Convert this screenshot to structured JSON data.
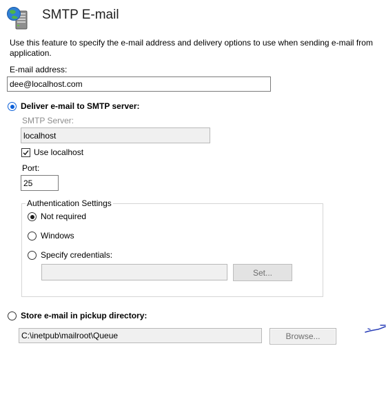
{
  "header": {
    "title": "SMTP E-mail",
    "icon": "smtp-server-icon"
  },
  "description": "Use this feature to specify the e-mail address and delivery options to use when sending e-mail from application.",
  "email": {
    "label": "E-mail address:",
    "value": "dee@localhost.com"
  },
  "deliver_smtp": {
    "label": "Deliver e-mail to SMTP server:",
    "selected": true,
    "smtp_server": {
      "label": "SMTP Server:",
      "value": "localhost",
      "enabled": false
    },
    "use_localhost": {
      "label": "Use localhost",
      "checked": true
    },
    "port": {
      "label": "Port:",
      "value": "25"
    },
    "authentication": {
      "legend": "Authentication Settings",
      "options": [
        {
          "label": "Not required",
          "selected": true
        },
        {
          "label": "Windows",
          "selected": false
        },
        {
          "label": "Specify credentials:",
          "selected": false
        }
      ],
      "credentials_value": "",
      "set_button": "Set..."
    }
  },
  "pickup_directory": {
    "label": "Store e-mail in pickup directory:",
    "selected": false,
    "path": "C:\\inetpub\\mailroot\\Queue",
    "browse_button": "Browse..."
  },
  "colors": {
    "accent": "#0a5fd8",
    "disabled_bg": "#f0f0f0",
    "annotation": "#2a3fb8"
  }
}
